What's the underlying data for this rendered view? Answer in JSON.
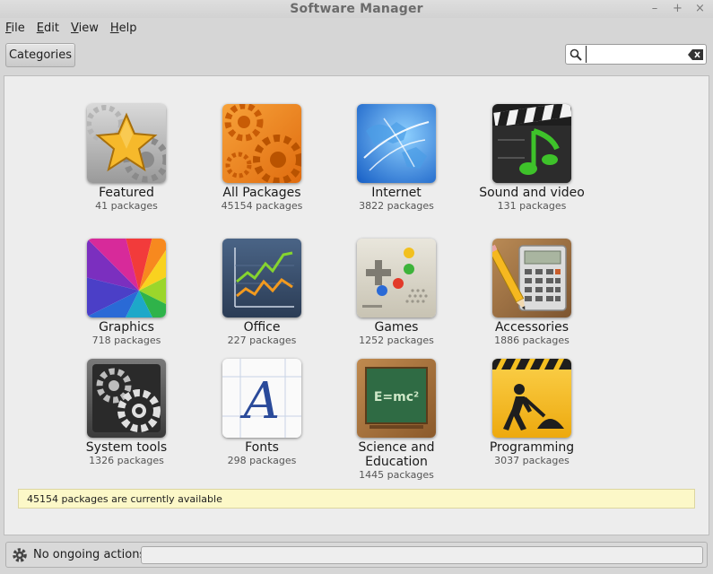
{
  "window": {
    "title": "Software Manager",
    "controls": {
      "minimize": "–",
      "maximize": "+",
      "close": "×"
    }
  },
  "menu": [
    {
      "accel": "F",
      "rest": "ile"
    },
    {
      "accel": "E",
      "rest": "dit"
    },
    {
      "accel": "V",
      "rest": "iew"
    },
    {
      "accel": "H",
      "rest": "elp"
    }
  ],
  "toolbar": {
    "categories_label": "Categories",
    "search_value": "",
    "search_placeholder": ""
  },
  "categories": [
    {
      "name": "Featured",
      "count": "41 packages",
      "icon": "featured-star-icon"
    },
    {
      "name": "All Packages",
      "count": "45154 packages",
      "icon": "all-packages-gears-icon"
    },
    {
      "name": "Internet",
      "count": "3822 packages",
      "icon": "internet-globe-icon"
    },
    {
      "name": "Sound and video",
      "count": "131 packages",
      "icon": "sound-video-clapper-icon"
    },
    {
      "name": "Graphics",
      "count": "718 packages",
      "icon": "graphics-color-wheel-icon"
    },
    {
      "name": "Office",
      "count": "227 packages",
      "icon": "office-chart-icon"
    },
    {
      "name": "Games",
      "count": "1252 packages",
      "icon": "games-gamepad-icon"
    },
    {
      "name": "Accessories",
      "count": "1886 packages",
      "icon": "accessories-calculator-icon"
    },
    {
      "name": "System tools",
      "count": "1326 packages",
      "icon": "system-tools-gears-icon"
    },
    {
      "name": "Fonts",
      "count": "298 packages",
      "icon": "fonts-letter-a-icon"
    },
    {
      "name": "Science and Education",
      "count": "1445 packages",
      "icon": "science-chalkboard-icon"
    },
    {
      "name": "Programming",
      "count": "3037 packages",
      "icon": "programming-construction-icon"
    }
  ],
  "chalkboard_text": "E=mc²",
  "fonts_letter": "A",
  "info_message": "45154 packages are currently available",
  "status": {
    "text": "No ongoing actions",
    "progress": 0
  }
}
